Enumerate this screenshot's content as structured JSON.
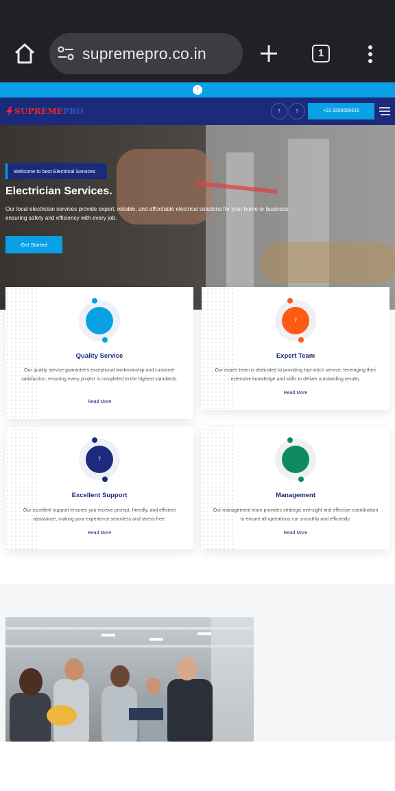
{
  "browser": {
    "url": "supremepro.co.in",
    "tab_count": "1"
  },
  "topstrip": {
    "icon_glyph": "?"
  },
  "nav": {
    "logo_part1": "SUPREME",
    "logo_part2": "PRO",
    "icon_glyph_1": "?",
    "icon_glyph_2": "?",
    "phone": "+91 9356699616"
  },
  "hero": {
    "badge": "Welcome to best Electrical Services",
    "title": "Electrician Services.",
    "description": "Our local electrician services provide expert, reliable, and affordable electrical solutions for your home or business, ensuring safety and efficiency with every job.",
    "cta": "Get Started"
  },
  "services": [
    {
      "title": "Quality Service",
      "text": "Our quality service guarantees exceptional workmanship and customer satisfaction, ensuring every project is completed to the highest standards.",
      "link": "Read More",
      "icon_glyph": "",
      "color": "#0aa0e6"
    },
    {
      "title": "Expert Team",
      "text": "Our expert team is dedicated to providing top-notch service, leveraging their extensive knowledge and skills to deliver outstanding results.",
      "link": "Read More",
      "icon_glyph": "?",
      "color": "#ff5a12"
    },
    {
      "title": "Excellent Support",
      "text": "Our excellent support ensures you receive prompt, friendly, and efficient assistance, making your experience seamless and stress-free.",
      "link": "Read More",
      "icon_glyph": "?",
      "color": "#1b2a7a"
    },
    {
      "title": "Management",
      "text": "Our management team provides strategic oversight and effective coordination to ensure all operations run smoothly and efficiently.",
      "link": "Read More",
      "icon_glyph": "",
      "color": "#0f8a5f"
    }
  ],
  "colors": {
    "primary": "#1b2a7a",
    "accent": "#0aa0e6",
    "logo_red": "#e32a2a"
  }
}
